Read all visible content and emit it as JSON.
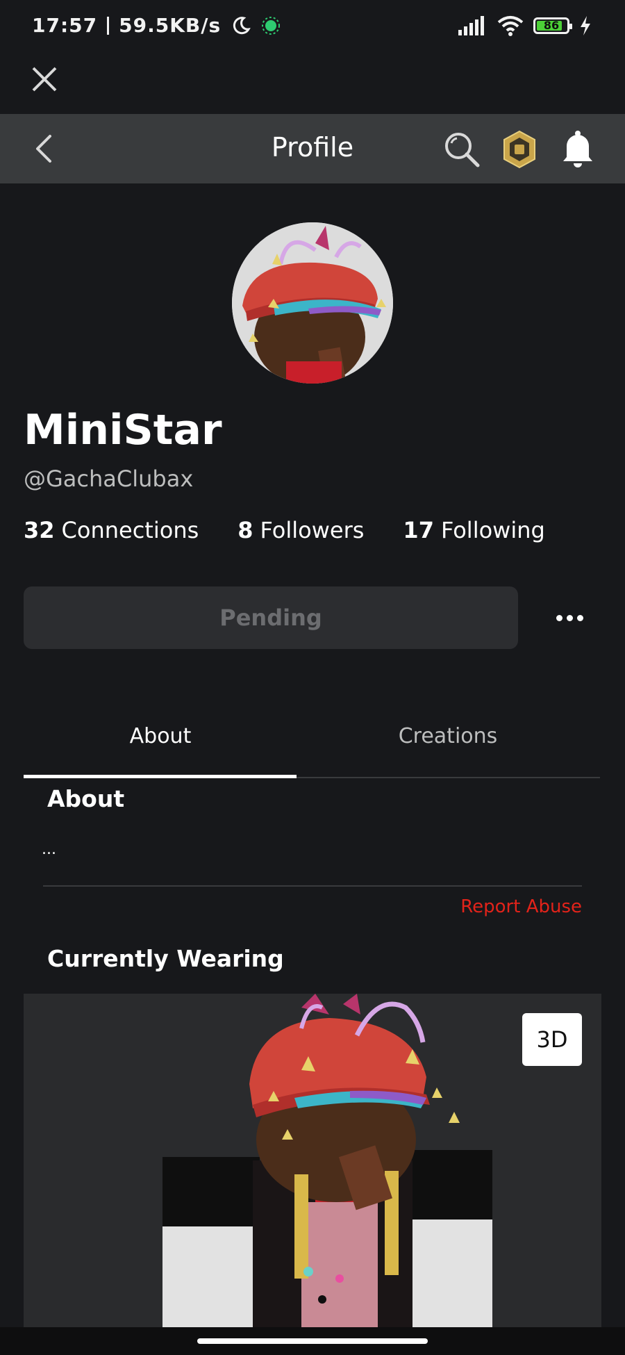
{
  "status_bar": {
    "time": "17:57",
    "network_speed": "59.5KB/s",
    "battery_level": "86",
    "battery_fraction": 0.86,
    "icons": [
      "moon-icon",
      "dot-indicator-icon",
      "signal-icon",
      "wifi-icon",
      "battery-icon",
      "charging-icon"
    ]
  },
  "close_icon": "close-icon",
  "header": {
    "title": "Profile",
    "back_icon": "chevron-left-icon",
    "search_icon": "search-icon",
    "robux_icon": "robux-icon",
    "notification_icon": "bell-icon"
  },
  "profile": {
    "display_name": "MiniStar",
    "username": "@GachaClubax",
    "stats": [
      {
        "count": "32",
        "label": "Connections"
      },
      {
        "count": "8",
        "label": "Followers"
      },
      {
        "count": "17",
        "label": "Following"
      }
    ],
    "action_button": "Pending",
    "more_icon": "more-horizontal-icon"
  },
  "tabs": [
    {
      "label": "About",
      "selected": true
    },
    {
      "label": "Creations",
      "selected": false
    }
  ],
  "about": {
    "heading": "About",
    "text": "...",
    "report_label": "Report Abuse"
  },
  "wearing": {
    "heading": "Currently Wearing",
    "view_toggle": "3D"
  },
  "colors": {
    "background": "#17181b",
    "header": "#393b3d",
    "button": "#2c2d30",
    "report": "#e2231a",
    "battery": "#4cd137"
  }
}
